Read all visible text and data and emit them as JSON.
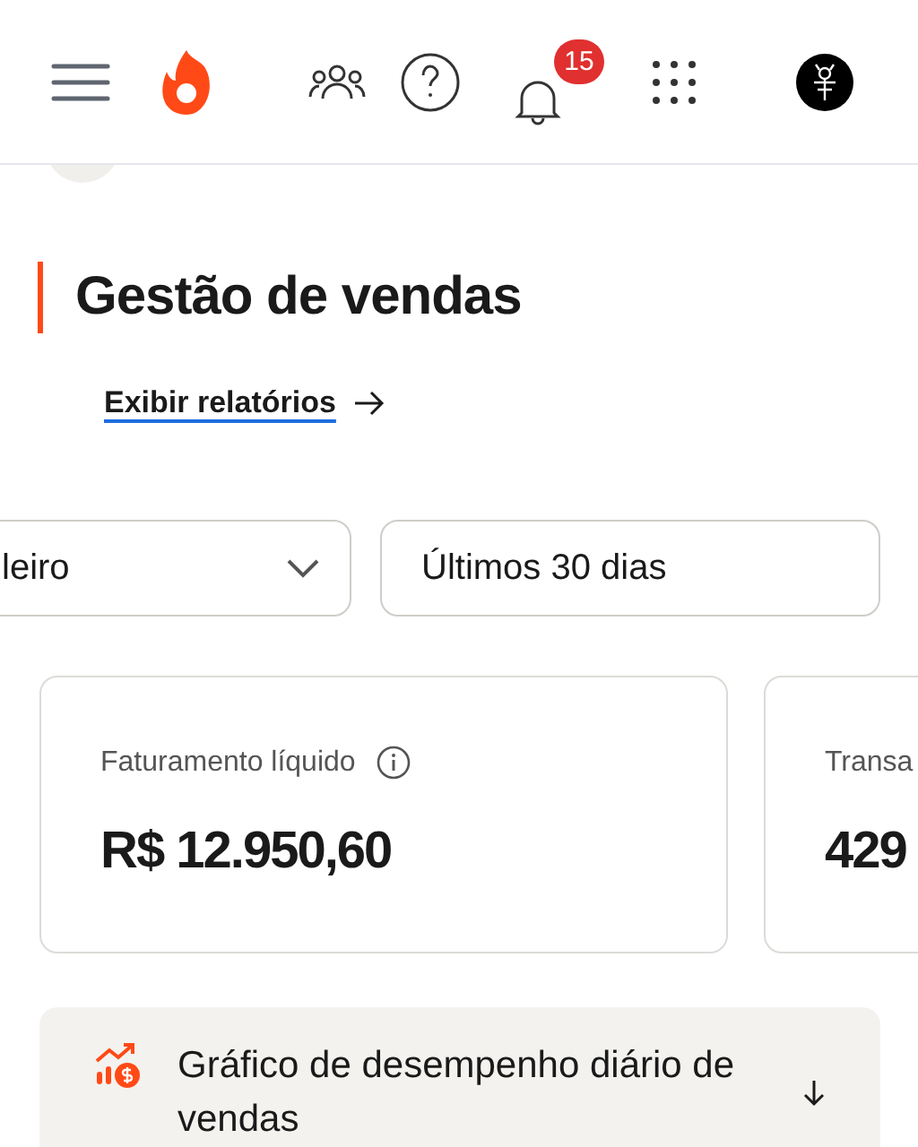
{
  "header": {
    "notification_count": "15"
  },
  "page": {
    "title": "Gestão de vendas",
    "report_link": "Exibir relatórios"
  },
  "filters": [
    {
      "kind": "select",
      "value": "leiro"
    },
    {
      "kind": "field",
      "value": "Últimos 30 dias"
    }
  ],
  "metrics": [
    {
      "label": "Faturamento líquido",
      "info": true,
      "value": "R$ 12.950,60"
    },
    {
      "label": "Transa",
      "info": false,
      "value": "429"
    }
  ],
  "accordion": {
    "title": "Gráfico de desempenho diário de vendas",
    "expanded": false
  }
}
